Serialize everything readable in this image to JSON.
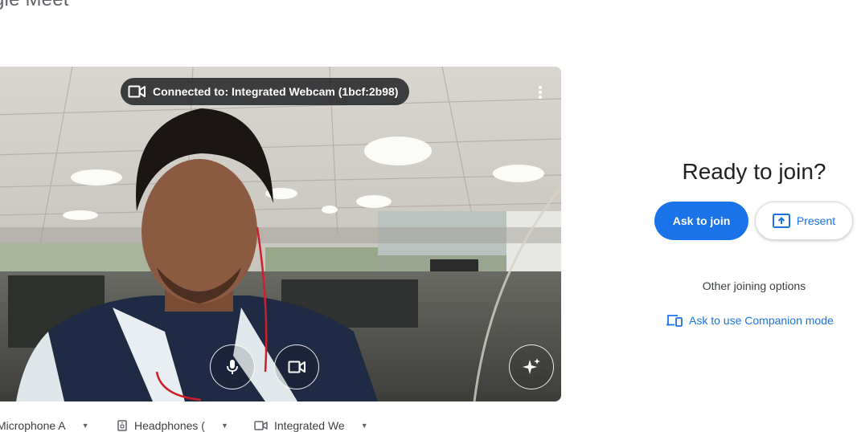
{
  "app": {
    "logo_text": "gle Meet"
  },
  "preview": {
    "camera_status": "Connected to: Integrated Webcam (1bcf:2b98)",
    "icons": {
      "camera_status": "video-camera-icon",
      "more": "more-vert-icon",
      "mic": "mic-icon",
      "camera": "video-camera-icon",
      "effects": "sparkle-icon"
    }
  },
  "devices": {
    "microphone": "Microphone A",
    "speaker": "Headphones (",
    "camera": "Integrated We"
  },
  "join_panel": {
    "title": "Ready to join?",
    "ask_to_join": "Ask to join",
    "present": "Present",
    "other_options": "Other joining options",
    "companion_mode": "Ask to use Companion mode"
  },
  "colors": {
    "accent": "#1a73e8",
    "pill_bg": "#202124"
  }
}
